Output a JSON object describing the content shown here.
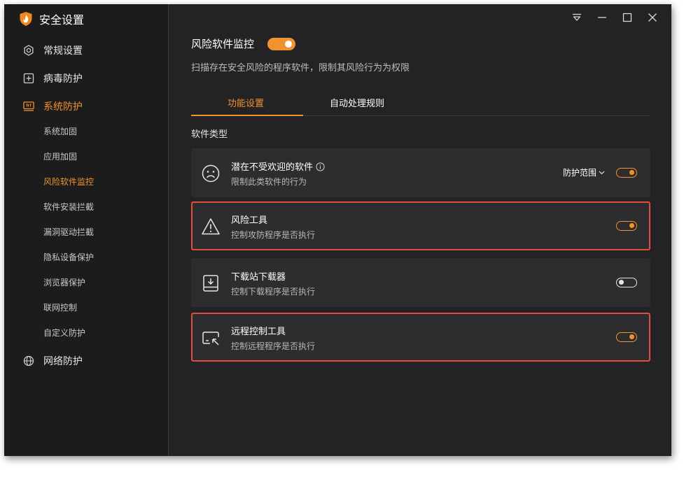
{
  "app": {
    "title": "安全设置",
    "accent": "#f0922d",
    "highlight_color": "#e04e3e"
  },
  "sidebar": {
    "items": [
      {
        "label": "常规设置",
        "icon": "gear-icon"
      },
      {
        "label": "病毒防护",
        "icon": "plus-square-icon"
      },
      {
        "label": "系统防护",
        "icon": "system-protect-icon",
        "active": true
      },
      {
        "label": "网络防护",
        "icon": "globe-icon"
      }
    ],
    "sub_items": [
      {
        "label": "系统加固"
      },
      {
        "label": "应用加固"
      },
      {
        "label": "风险软件监控",
        "active": true
      },
      {
        "label": "软件安装拦截"
      },
      {
        "label": "漏洞驱动拦截"
      },
      {
        "label": "隐私设备保护"
      },
      {
        "label": "浏览器保护"
      },
      {
        "label": "联网控制"
      },
      {
        "label": "自定义防护"
      }
    ]
  },
  "titlebar": {
    "icons": [
      "menu-icon",
      "minimize-icon",
      "maximize-icon",
      "close-icon"
    ]
  },
  "page": {
    "title": "风险软件监控",
    "enabled": true,
    "description": "扫描存在安全风险的程序软件，限制其风险行为为权限"
  },
  "tabs": [
    {
      "label": "功能设置",
      "active": true
    },
    {
      "label": "自动处理规则",
      "active": false
    }
  ],
  "section": {
    "label": "软件类型"
  },
  "cards": [
    {
      "name": "潜在不受欢迎的软件",
      "desc": "限制此类软件的行为",
      "icon": "frown-face-icon",
      "scope_label": "防护范围",
      "enabled": true,
      "highlighted": false
    },
    {
      "name": "风险工具",
      "desc": "控制攻防程序是否执行",
      "icon": "warning-triangle-icon",
      "enabled": true,
      "highlighted": true
    },
    {
      "name": "下载站下载器",
      "desc": "控制下载程序是否执行",
      "icon": "download-icon",
      "enabled": false,
      "highlighted": false
    },
    {
      "name": "远程控制工具",
      "desc": "控制远程程序是否执行",
      "icon": "remote-control-icon",
      "enabled": true,
      "highlighted": true
    }
  ]
}
